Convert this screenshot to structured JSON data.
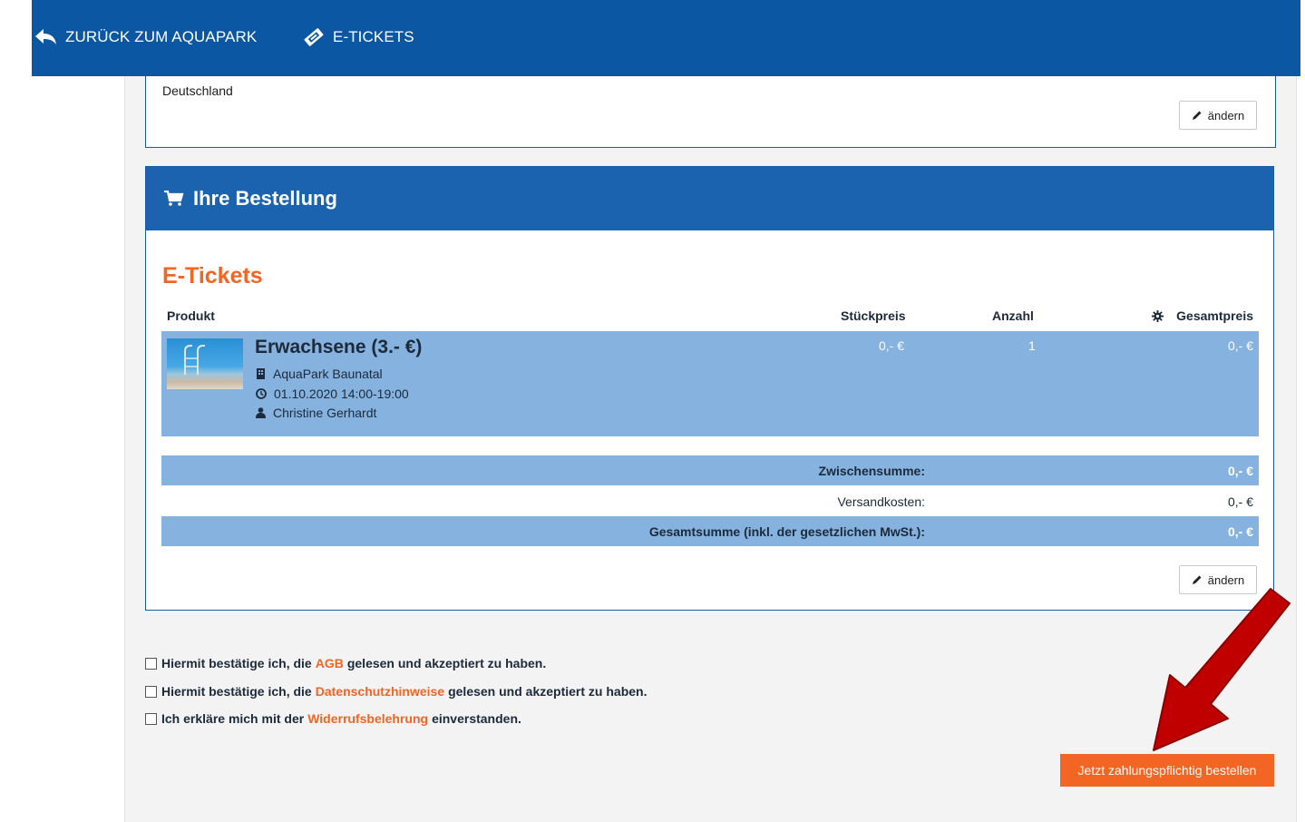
{
  "nav": {
    "back_label": "ZURÜCK ZUM AQUAPARK",
    "tickets_label": "E-TICKETS"
  },
  "address": {
    "country": "Deutschland",
    "edit_label": "ändern"
  },
  "order": {
    "title": "Ihre Bestellung",
    "section_title": "E-Tickets",
    "columns": {
      "product": "Produkt",
      "unit_price": "Stückpreis",
      "quantity": "Anzahl",
      "total": "Gesamtpreis"
    },
    "item": {
      "name": "Erwachsene (3.- €)",
      "location": "AquaPark Baunatal",
      "datetime": "01.10.2020 14:00-19:00",
      "person": "Christine Gerhardt",
      "unit_price": "0,- €",
      "quantity": "1",
      "total": "0,- €"
    },
    "subtotal_label": "Zwischensumme:",
    "subtotal_value": "0,- €",
    "shipping_label": "Versandkosten:",
    "shipping_value": "0,- €",
    "grand_total_label": "Gesamtsumme (inkl. der gesetzlichen MwSt.):",
    "grand_total_value": "0,- €",
    "edit_label": "ändern"
  },
  "consents": [
    {
      "before": "Hiermit bestätige ich, die",
      "link": "AGB",
      "after": "gelesen und akzeptiert zu haben."
    },
    {
      "before": "Hiermit bestätige ich, die",
      "link": "Datenschutzhinweise",
      "after": "gelesen und akzeptiert zu haben."
    },
    {
      "before": "Ich erkläre mich mit der",
      "link": "Widerrufsbelehrung",
      "after": "einverstanden."
    }
  ],
  "submit_label": "Jetzt zahlungspflichtig bestellen",
  "colors": {
    "nav_blue": "#0b57a4",
    "header_blue": "#1b63ae",
    "row_blue": "#85b2de",
    "accent_orange": "#f26522",
    "arrow_red": "#c00000"
  }
}
